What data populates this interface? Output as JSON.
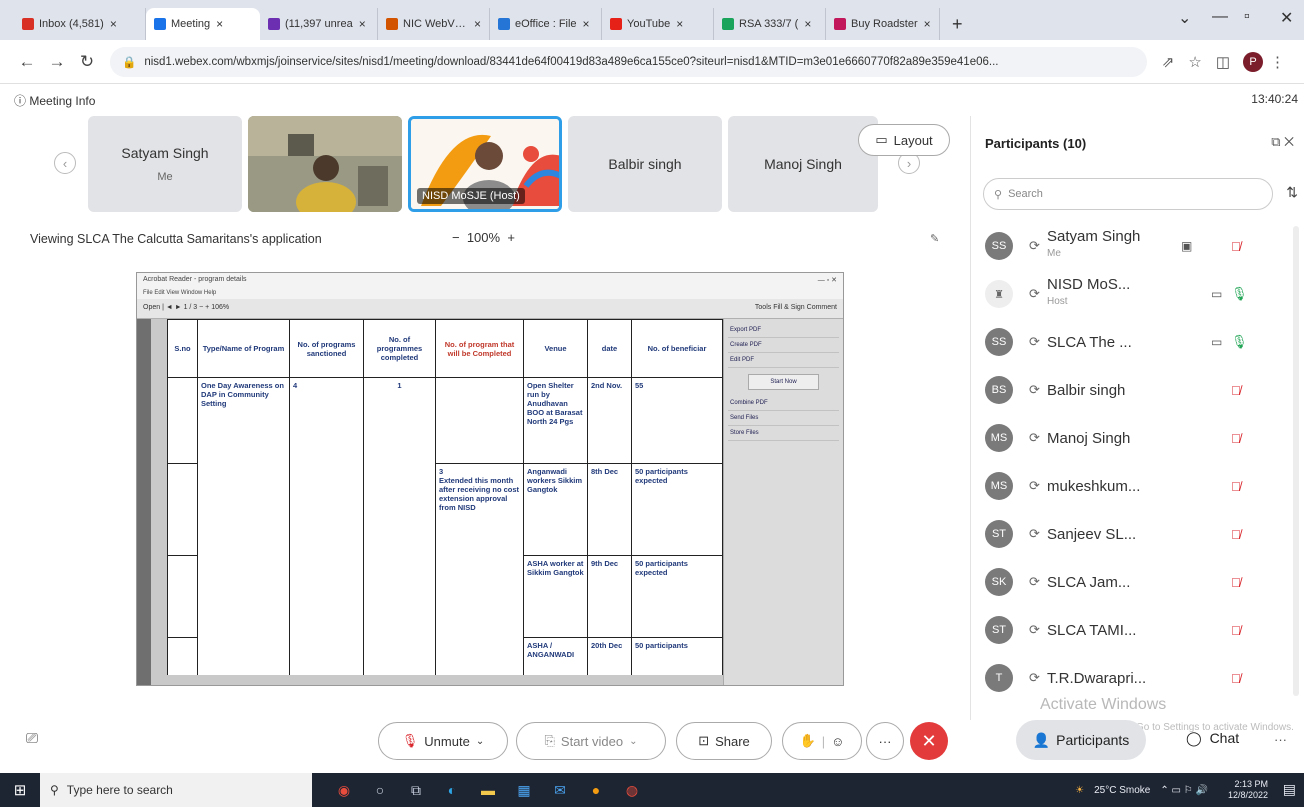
{
  "browser": {
    "tabs": [
      {
        "label": "Inbox (4,581)",
        "color": "#d93025"
      },
      {
        "label": "Meeting",
        "color": "#1a73e8",
        "active": true
      },
      {
        "label": "(11,397 unrea",
        "color": "#6c2fb2"
      },
      {
        "label": "NIC WebVPN",
        "color": "#d35400"
      },
      {
        "label": "eOffice : File",
        "color": "#2475d6"
      },
      {
        "label": "YouTube",
        "color": "#e62117"
      },
      {
        "label": "RSA 333/7 (",
        "color": "#1aa35b"
      },
      {
        "label": "Buy Roadster",
        "color": "#c2185b"
      }
    ],
    "new_tab": "+",
    "url": "nisd1.webex.com/wbxmjs/joinservice/sites/nisd1/meeting/download/83441de64f00419d83a489e6ca155ce0?siteurl=nisd1&MTID=m3e01e6660770f82a89e359e41e06..."
  },
  "meeting": {
    "info_label": "Meeting Info",
    "clock": "13:40:24",
    "layout_label": "Layout",
    "tiles": [
      {
        "name": "Satyam Singh",
        "sub": "Me"
      },
      {
        "name": "",
        "sub": ""
      },
      {
        "name": "",
        "sub": "",
        "host_label": "NISD  MoSJE (Host)"
      },
      {
        "name": "Balbir singh",
        "sub": ""
      },
      {
        "name": "Manoj Singh",
        "sub": ""
      }
    ],
    "viewing": "Viewing SLCA The Calcutta Samaritans's application",
    "zoom": "100%",
    "zoom_minus": "−",
    "zoom_plus": "+"
  },
  "shared_doc": {
    "title": "Acrobat Reader - program details",
    "menu": "File  Edit  View  Window  Help",
    "toolbar_left": "Open   |  ◄  ►  1 / 3   −  +  106%",
    "toolbar_right": "Tools   Fill & Sign   Comment",
    "headers": [
      "S.no",
      "Type/Name of Program",
      "No. of programs sanctioned",
      "No. of programmes completed",
      "No. of program that will be Completed",
      "Venue",
      "date",
      "No. of beneficiar"
    ],
    "rows": [
      {
        "sno": "",
        "type": "One Day Awareness on DAP in Community Setting",
        "sanctioned": "4",
        "completed": "1",
        "will_complete": "",
        "venue": "Open Shelter run by Anudhavan BOO at Barasat North 24 Pgs",
        "date": "2nd Nov.",
        "beneficiaries": "55"
      },
      {
        "sno": "",
        "type": "",
        "sanctioned": "",
        "completed": "",
        "will_complete": "3\nExtended this month after receiving no cost extension approval from NISD",
        "venue": "Anganwadi workers Sikkim Gangtok",
        "date": "8th Dec",
        "beneficiaries": "50 participants expected"
      },
      {
        "sno": "",
        "type": "",
        "sanctioned": "",
        "completed": "",
        "will_complete": "",
        "venue": "ASHA worker at Sikkim Gangtok",
        "date": "9th Dec",
        "beneficiaries": "50 participants expected"
      },
      {
        "sno": "",
        "type": "",
        "sanctioned": "",
        "completed": "",
        "will_complete": "",
        "venue": "ASHA / ANGANWADI",
        "date": "20th Dec",
        "beneficiaries": "50 participants"
      }
    ],
    "right_panel": [
      "Export PDF",
      "Create PDF",
      "Edit PDF",
      "Combine PDF",
      "Send Files",
      "Store Files"
    ],
    "right_panel_button": "Start Now"
  },
  "participants": {
    "title": "Participants (10)",
    "search_placeholder": "Search",
    "list": [
      {
        "initials": "SS",
        "name": "Satyam Singh",
        "sub": "Me",
        "mic": "muted",
        "cam": "▣"
      },
      {
        "initials": "",
        "name": "NISD  MoS...",
        "sub": "Host",
        "mic": "on",
        "cam": "▭"
      },
      {
        "initials": "SS",
        "name": "SLCA The ...",
        "sub": "",
        "mic": "on",
        "cam": "▭"
      },
      {
        "initials": "BS",
        "name": "Balbir singh",
        "sub": "",
        "mic": "muted",
        "cam": ""
      },
      {
        "initials": "MS",
        "name": "Manoj Singh",
        "sub": "",
        "mic": "muted",
        "cam": ""
      },
      {
        "initials": "MS",
        "name": "mukeshkum...",
        "sub": "",
        "mic": "muted",
        "cam": ""
      },
      {
        "initials": "ST",
        "name": "Sanjeev SL...",
        "sub": "",
        "mic": "muted",
        "cam": ""
      },
      {
        "initials": "SK",
        "name": "SLCA Jam...",
        "sub": "",
        "mic": "muted",
        "cam": ""
      },
      {
        "initials": "ST",
        "name": "SLCA TAMI...",
        "sub": "",
        "mic": "muted",
        "cam": ""
      },
      {
        "initials": "T",
        "name": "T.R.Dwarapri...",
        "sub": "",
        "mic": "muted",
        "cam": ""
      }
    ],
    "watermark_title": "Activate Windows",
    "watermark_sub": "Go to Settings to activate Windows."
  },
  "controls": {
    "unmute": "Unmute",
    "start_video": "Start video",
    "share": "Share",
    "participants": "Participants",
    "chat": "Chat",
    "more": "···",
    "end": "✕"
  },
  "taskbar": {
    "search_placeholder": "Type here to search",
    "weather": "25°C  Smoke",
    "time": "2:13 PM",
    "date": "12/8/2022"
  }
}
